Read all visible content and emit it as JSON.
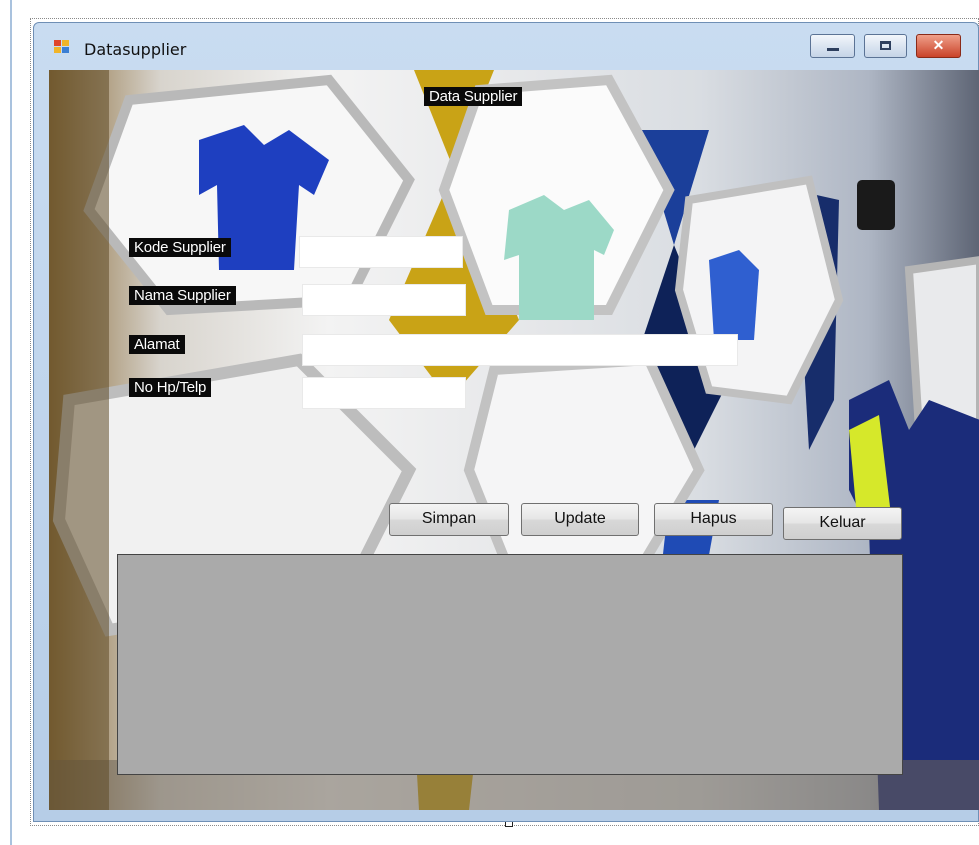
{
  "window": {
    "title": "Datasupplier",
    "controls": {
      "minimize": "minimize-button",
      "maximize": "maximize-button",
      "close": "close-button"
    }
  },
  "form": {
    "header": "Data Supplier",
    "fields": [
      {
        "label": "Kode Supplier",
        "value": "",
        "placeholder": ""
      },
      {
        "label": "Nama Supplier",
        "value": "",
        "placeholder": ""
      },
      {
        "label": "Alamat",
        "value": "",
        "placeholder": ""
      },
      {
        "label": "No Hp/Telp",
        "value": "",
        "placeholder": ""
      }
    ],
    "buttons": {
      "simpan": "Simpan",
      "update": "Update",
      "hapus": "Hapus",
      "keluar": "Keluar"
    }
  },
  "colors": {
    "close_button": "#c9432a",
    "grid_background": "#aaaaaa",
    "label_background": "#0a0a0a"
  },
  "icons": [
    "app-icon",
    "minimize-icon",
    "maximize-icon",
    "close-icon"
  ]
}
